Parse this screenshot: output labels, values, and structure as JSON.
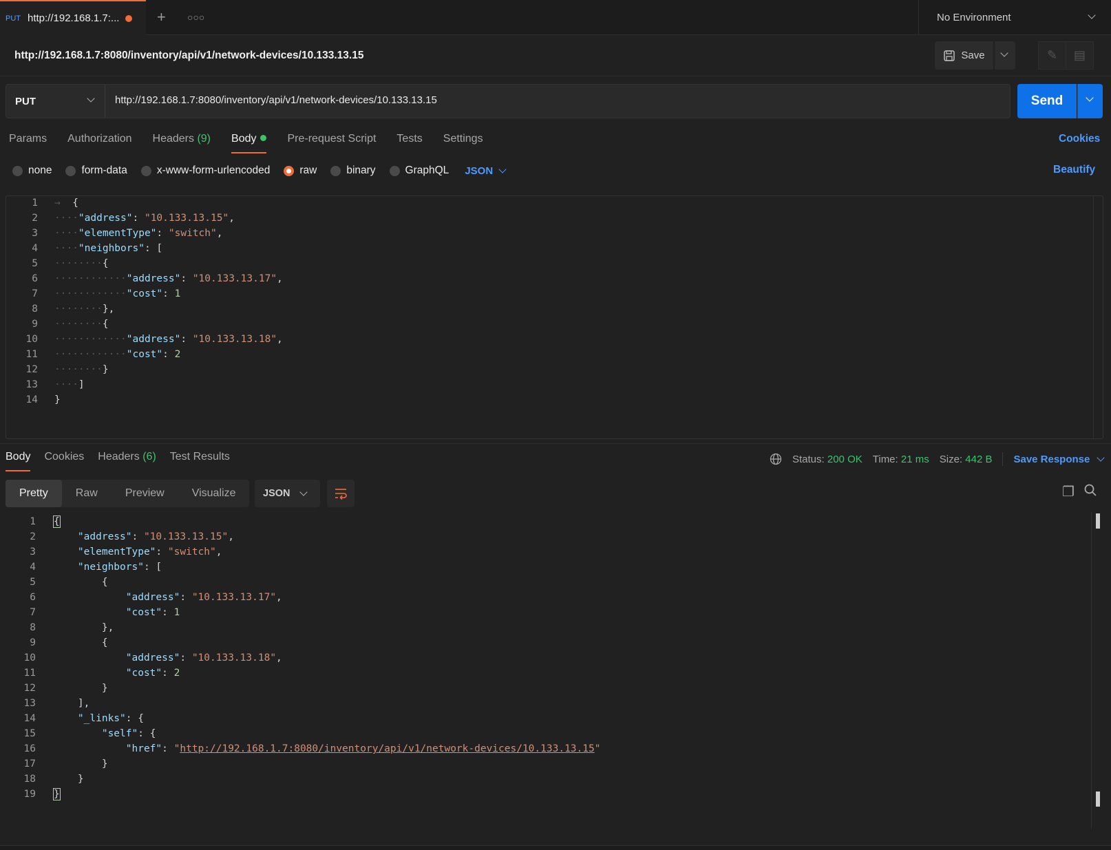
{
  "tab": {
    "method": "PUT",
    "title": "http://192.168.1.7:..."
  },
  "environment": "No Environment",
  "request": {
    "title": "http://192.168.1.7:8080/inventory/api/v1/network-devices/10.133.13.15",
    "method": "PUT",
    "url": "http://192.168.1.7:8080/inventory/api/v1/network-devices/10.133.13.15",
    "save_label": "Save",
    "send_label": "Send"
  },
  "request_tabs": [
    {
      "label": "Params"
    },
    {
      "label": "Authorization"
    },
    {
      "label": "Headers",
      "count": "(9)"
    },
    {
      "label": "Body"
    },
    {
      "label": "Pre-request Script"
    },
    {
      "label": "Tests"
    },
    {
      "label": "Settings"
    }
  ],
  "cookies_link": "Cookies",
  "body_types": [
    "none",
    "form-data",
    "x-www-form-urlencoded",
    "raw",
    "binary",
    "GraphQL"
  ],
  "body_format": "JSON",
  "beautify_label": "Beautify",
  "request_body_lines": [
    [
      "1"
    ],
    [
      "2"
    ],
    [
      "3"
    ],
    [
      "4"
    ],
    [
      "5"
    ],
    [
      "6"
    ],
    [
      "7"
    ],
    [
      "8"
    ],
    [
      "9"
    ],
    [
      "10"
    ],
    [
      "11"
    ],
    [
      "12"
    ],
    [
      "13"
    ],
    [
      "14"
    ]
  ],
  "request_body": {
    "address": "10.133.13.15",
    "elementType": "switch",
    "neighbor1_address": "10.133.13.17",
    "neighbor1_cost": "1",
    "neighbor2_address": "10.133.13.18",
    "neighbor2_cost": "2"
  },
  "response_tabs": [
    {
      "label": "Body"
    },
    {
      "label": "Cookies"
    },
    {
      "label": "Headers",
      "count": "(6)"
    },
    {
      "label": "Test Results"
    }
  ],
  "status": {
    "status_label": "Status:",
    "status_value": "200 OK",
    "time_label": "Time:",
    "time_value": "21 ms",
    "size_label": "Size:",
    "size_value": "442 B",
    "save_response": "Save Response"
  },
  "view_modes": [
    "Pretty",
    "Raw",
    "Preview",
    "Visualize"
  ],
  "response_format": "JSON",
  "response_body": {
    "address": "10.133.13.15",
    "elementType": "switch",
    "neighbor1_address": "10.133.13.17",
    "neighbor1_cost": "1",
    "neighbor2_address": "10.133.13.18",
    "neighbor2_cost": "2",
    "href": "http://192.168.1.7:8080/inventory/api/v1/network-devices/10.133.13.15"
  },
  "icons": {
    "new_tab": "plus-icon",
    "more": "more-icon",
    "save": "floppy-icon",
    "edit": "pencil-icon",
    "comment": "comment-icon",
    "globe": "globe-icon",
    "copy": "copy-icon",
    "search": "search-icon",
    "wrap": "wrap-icon"
  },
  "colors": {
    "accent": "#f26b3a",
    "send": "#0f71e8",
    "success": "#3cc46b",
    "link": "#4d9bff"
  }
}
